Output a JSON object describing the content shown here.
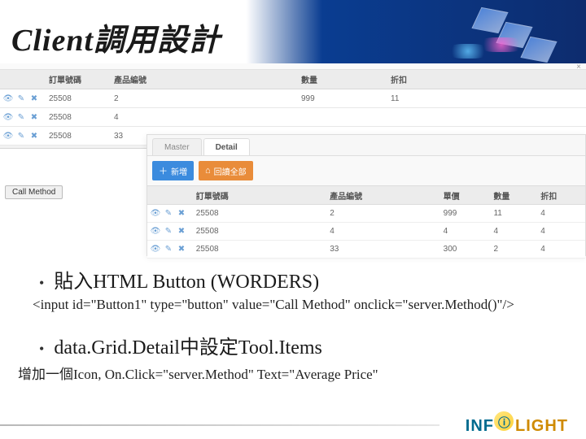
{
  "header": {
    "title": "Client調用設計"
  },
  "screenshot1": {
    "cols": {
      "order": "訂單號碼",
      "product": "產品編號",
      "qty": "數量",
      "discount": "折扣"
    },
    "rows": [
      {
        "order": "25508",
        "product": "2",
        "qty": "999",
        "discount": "11"
      },
      {
        "order": "25508",
        "product": "4",
        "qty": "",
        "discount": ""
      },
      {
        "order": "25508",
        "product": "33",
        "qty": "",
        "discount": ""
      }
    ]
  },
  "screenshot2": {
    "tabs": {
      "master": "Master",
      "detail": "Detail"
    },
    "toolbar": {
      "add": "新増",
      "refreshBefore": "回讀全部"
    },
    "cols": {
      "order": "訂單號碼",
      "product": "產品編號",
      "price": "單價",
      "qty": "數量",
      "discount": "折扣"
    },
    "rows": [
      {
        "order": "25508",
        "product": "2",
        "price": "999",
        "qty": "11",
        "discount": "4"
      },
      {
        "order": "25508",
        "product": "4",
        "price": "4",
        "qty": "4",
        "discount": "4"
      },
      {
        "order": "25508",
        "product": "33",
        "price": "300",
        "qty": "2",
        "discount": "4"
      }
    ]
  },
  "callMethodBtn": "Call Method",
  "bullets": {
    "b1": "貼入HTML Button (WORDERS)",
    "code": "<input id=\"Button1\" type=\"button\" value=\"Call Method\" onclick=\"server.Method()\"/>",
    "b2": "data.Grid.Detail中設定Tool.Items",
    "desc": "增加一個Icon, On.Click=\"server.Method\" Text=\"Average Price\""
  },
  "footer": {
    "brand1": "INF",
    "brand2": "LIGHT"
  }
}
